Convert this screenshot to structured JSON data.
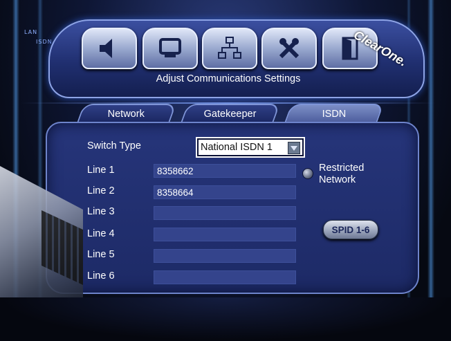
{
  "header": {
    "title": "Adjust Communications Settings",
    "brand": "ClearOne.",
    "mode_lan": "LAN",
    "mode_isdn": "ISDN",
    "icons": [
      "speaker-icon",
      "monitor-icon",
      "network-icon",
      "tools-icon",
      "exit-door-icon"
    ]
  },
  "tabs": [
    {
      "label": "Network",
      "active": false
    },
    {
      "label": "Gatekeeper",
      "active": false
    },
    {
      "label": "ISDN",
      "active": true
    }
  ],
  "form": {
    "switch_type_label": "Switch Type",
    "switch_type_value": "National ISDN 1",
    "lines": [
      {
        "label": "Line 1",
        "value": "8358662"
      },
      {
        "label": "Line 2",
        "value": "8358664"
      },
      {
        "label": "Line 3",
        "value": ""
      },
      {
        "label": "Line 4",
        "value": ""
      },
      {
        "label": "Line 5",
        "value": ""
      },
      {
        "label": "Line 6",
        "value": ""
      }
    ],
    "restricted_line1": "Restricted",
    "restricted_line2": "Network",
    "spid_button": "SPID 1-6"
  },
  "colors": {
    "panel": "#26357a",
    "field": "#34448c",
    "accent": "#7f95d8"
  }
}
